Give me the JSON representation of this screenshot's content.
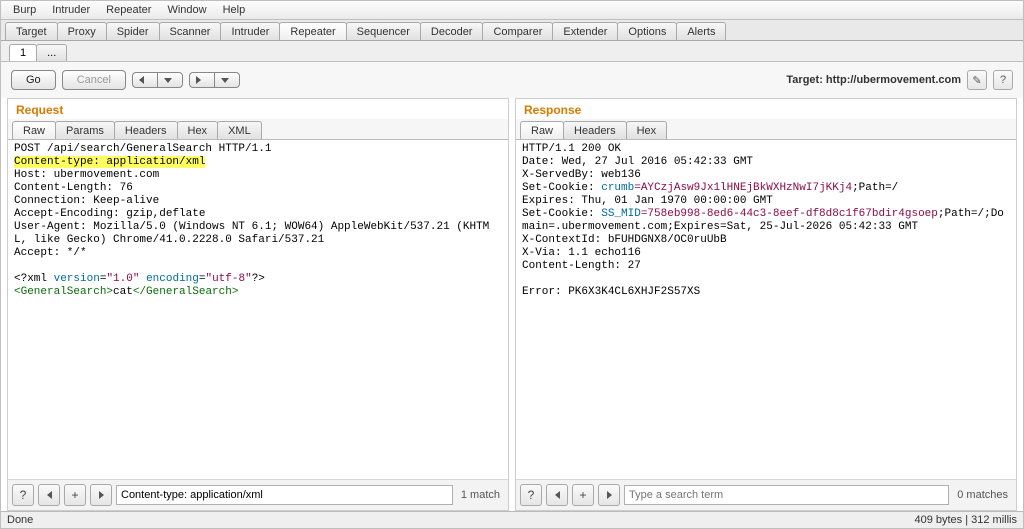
{
  "menu": {
    "items": [
      "Burp",
      "Intruder",
      "Repeater",
      "Window",
      "Help"
    ]
  },
  "main_tabs": [
    "Target",
    "Proxy",
    "Spider",
    "Scanner",
    "Intruder",
    "Repeater",
    "Sequencer",
    "Decoder",
    "Comparer",
    "Extender",
    "Options",
    "Alerts"
  ],
  "main_tab_active_index": 5,
  "sub_tabs": [
    "1",
    "..."
  ],
  "toolbar": {
    "go_label": "Go",
    "cancel_label": "Cancel",
    "target_label": "Target: http://ubermovement.com"
  },
  "request": {
    "title": "Request",
    "view_tabs": [
      "Raw",
      "Params",
      "Headers",
      "Hex",
      "XML"
    ],
    "active_view": 0,
    "lines": {
      "l1": "POST /api/search/GeneralSearch HTTP/1.1",
      "l2": "Content-type: application/xml",
      "l3": "Host: ubermovement.com",
      "l4": "Content-Length: 76",
      "l5": "Connection: Keep-alive",
      "l6": "Accept-Encoding: gzip,deflate",
      "l7": "User-Agent: Mozilla/5.0 (Windows NT 6.1; WOW64) AppleWebKit/537.21 (KHTML, like Gecko) Chrome/41.0.2228.0 Safari/537.21",
      "l8": "Accept: */*",
      "xml_decl_open": "<?xml ",
      "xml_ver_kw": "version",
      "xml_ver_val": "\"1.0\"",
      "xml_enc_kw": "encoding",
      "xml_enc_val": "\"utf-8\"",
      "xml_decl_close": "?>",
      "body_open": "<GeneralSearch>",
      "body_text": "cat",
      "body_close": "</GeneralSearch>"
    },
    "search": {
      "value": "Content-type: application/xml",
      "placeholder": "Type a search term",
      "matches_label": "1 match"
    }
  },
  "response": {
    "title": "Response",
    "view_tabs": [
      "Raw",
      "Headers",
      "Hex"
    ],
    "active_view": 0,
    "lines": {
      "l1": "HTTP/1.1 200 OK",
      "l2": "Date: Wed, 27 Jul 2016 05:42:33 GMT",
      "l3": "X-ServedBy: web136",
      "l4a": "Set-Cookie: ",
      "l4b": "crumb",
      "l4c": "=AYCzjAsw9Jx1lHNEjBkWXHzNwI7jKKj4",
      "l4d": ";Path=/",
      "l5": "Expires: Thu, 01 Jan 1970 00:00:00 GMT",
      "l6": "Set-Cookie: ",
      "l6b": "SS_MID",
      "l6c": "=758eb998-8ed6-44c3-8eef-df8d8c1f67bdir4gsoep",
      "l6d": ";Path=/;Domain=.ubermovement.com;Expires=Sat, 25-Jul-2026 05:42:33 GMT",
      "l7": "X-ContextId: bFUHDGNX8/OC0ruUbB",
      "l8": "X-Via: 1.1 echo116",
      "l9": "Content-Length: 27",
      "body": "Error: PK6X3K4CL6XHJF2S57XS"
    },
    "search": {
      "value": "",
      "placeholder": "Type a search term",
      "matches_label": "0 matches"
    }
  },
  "status": {
    "left": "Done",
    "right": "409 bytes | 312 millis"
  },
  "icons": {
    "help": "?",
    "plus": "+",
    "pencil": "✎"
  }
}
